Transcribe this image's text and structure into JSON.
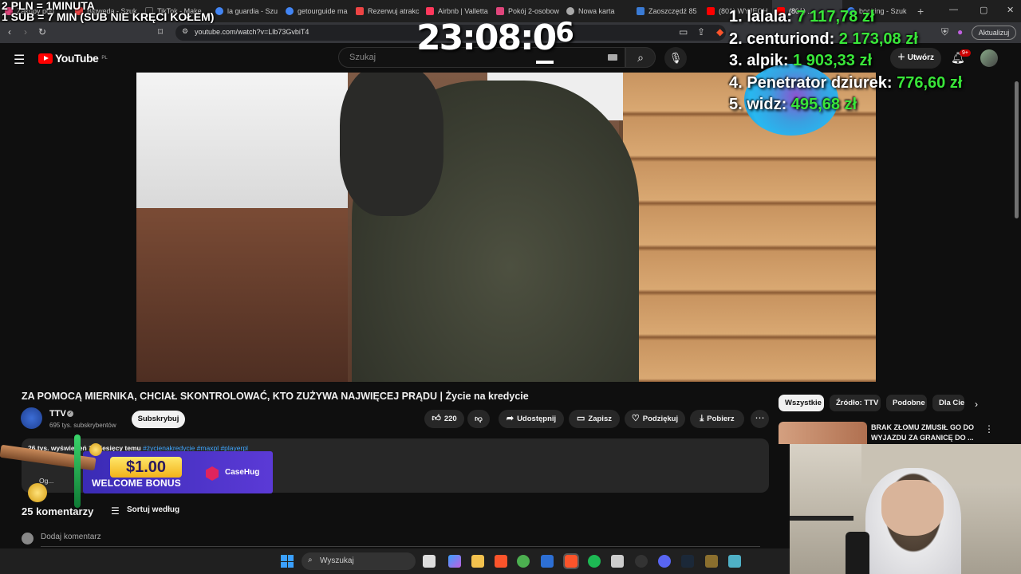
{
  "browser": {
    "tabs": [
      {
        "label": "Zakupy pod",
        "color": "#e0457b"
      },
      {
        "label": "Bigweda - Szuk",
        "color": "#e44"
      },
      {
        "label": "TikTok - Make",
        "color": "#222"
      },
      {
        "label": "la guardia - Szu",
        "color": "#4285f4"
      },
      {
        "label": "getourguide ma",
        "color": "#4285f4"
      },
      {
        "label": "Rezerwuj atrakc",
        "color": "#e44"
      },
      {
        "label": "Airbnb | Valletta",
        "color": "#ff385c"
      },
      {
        "label": "Pokój 2-osobow",
        "color": "#e0457b"
      },
      {
        "label": "Nowa karta",
        "color": "#aaa"
      },
      {
        "label": "Zaoszczędź 85",
        "color": "#3a7bd5"
      },
      {
        "label": "(801) WYJECH",
        "color": "#ff0000"
      },
      {
        "label": "(801) ...",
        "color": "#ff0000"
      },
      {
        "label": "booking - Szuk",
        "color": "#4285f4"
      }
    ],
    "url": "youtube.com/watch?v=Llb73GvbiT4",
    "update_label": "Aktualizuj"
  },
  "youtube": {
    "logo_text": "YouTube",
    "logo_country": "PL",
    "search_placeholder": "Szukaj",
    "create_label": "Utwórz",
    "notif_badge": "9+"
  },
  "overlay": {
    "rate_line1": "2 PLN = 1MINUTA",
    "rate_line2": "1 SUB = 7 MIN (SUB NIE KRĘCI KOŁEM)",
    "clock_main": "23:08:0",
    "clock_sup": "6",
    "leaderboard": [
      {
        "name": "1. lalala:",
        "amount": "7 117,78 zł"
      },
      {
        "name": "2. centuriond:",
        "amount": "2 173,08 zł"
      },
      {
        "name": "3. alpik:",
        "amount": "1 903,33 zł"
      },
      {
        "name": "4. Penetrator dziurek:",
        "amount": "776,60 zł"
      },
      {
        "name": "5. widz:",
        "amount": "495,68 zł"
      }
    ]
  },
  "video": {
    "title": "ZA POMOCĄ MIERNIKA, CHCIAŁ SKONTROLOWAĆ, KTO ZUŻYWA NAJWIĘCEJ PRĄDU | Życie na kredycie",
    "channel": "TTV",
    "subscribers": "695 tys. subskrybentów",
    "subscribe_label": "Subskrybuj",
    "likes": "220",
    "share_label": "Udostępnij",
    "save_label": "Zapisz",
    "thanks_label": "Podziękuj",
    "download_label": "Pobierz",
    "views": "26 tys. wyświetleń  1 miesięcy temu",
    "tags": "#życienakredycie #maxpl #playerpl",
    "desc_more": "Og..."
  },
  "ad": {
    "amount": "$1.00",
    "bonus": "WELCOME BONUS",
    "brand": "CaseHug"
  },
  "comments": {
    "count": "25 komentarzy",
    "sort_label": "Sortuj według",
    "add_placeholder": "Dodaj komentarz"
  },
  "sidebar": {
    "chips": [
      "Wszystkie",
      "Źródło: TTV",
      "Podobne",
      "Dla Ciebie"
    ],
    "rec_title": "BRAK ZŁOMU ZMUSIŁ GO DO WYJAZDU ZA GRANICĘ DO ..."
  },
  "taskbar": {
    "search_placeholder": "Wyszukaj"
  }
}
